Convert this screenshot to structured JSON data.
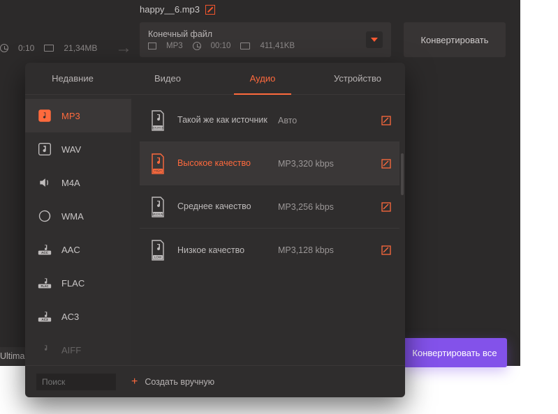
{
  "file": {
    "name": "happy__6.mp3"
  },
  "source_meta": {
    "duration": "0:10",
    "size": "21,34MB"
  },
  "dest": {
    "title": "Конечный файл",
    "format": "MP3",
    "duration": "00:10",
    "size": "411,41KB"
  },
  "convert_label": "Конвертировать",
  "convert_all_label": "Конвертировать все",
  "ultima_label": "Ultima",
  "tabs": {
    "recent": "Недавние",
    "video": "Видео",
    "audio": "Аудио",
    "device": "Устройство"
  },
  "sidebar": {
    "items": [
      {
        "label": "MP3"
      },
      {
        "label": "WAV"
      },
      {
        "label": "M4A"
      },
      {
        "label": "WMA"
      },
      {
        "label": "AAC"
      },
      {
        "label": "FLAC"
      },
      {
        "label": "AC3"
      },
      {
        "label": "AIFF"
      }
    ]
  },
  "presets": [
    {
      "name": "Такой же как источник",
      "spec": "Авто",
      "kind": "source"
    },
    {
      "name": "Высокое качество",
      "spec": "MP3,320 kbps",
      "kind": "high",
      "selected": true
    },
    {
      "name": "Среднее качество",
      "spec": "MP3,256 kbps",
      "kind": "medium"
    },
    {
      "name": "Низкое качество",
      "spec": "MP3,128 kbps",
      "kind": "low"
    }
  ],
  "footer": {
    "search_placeholder": "Поиск",
    "create_manual": "Создать вручную"
  }
}
